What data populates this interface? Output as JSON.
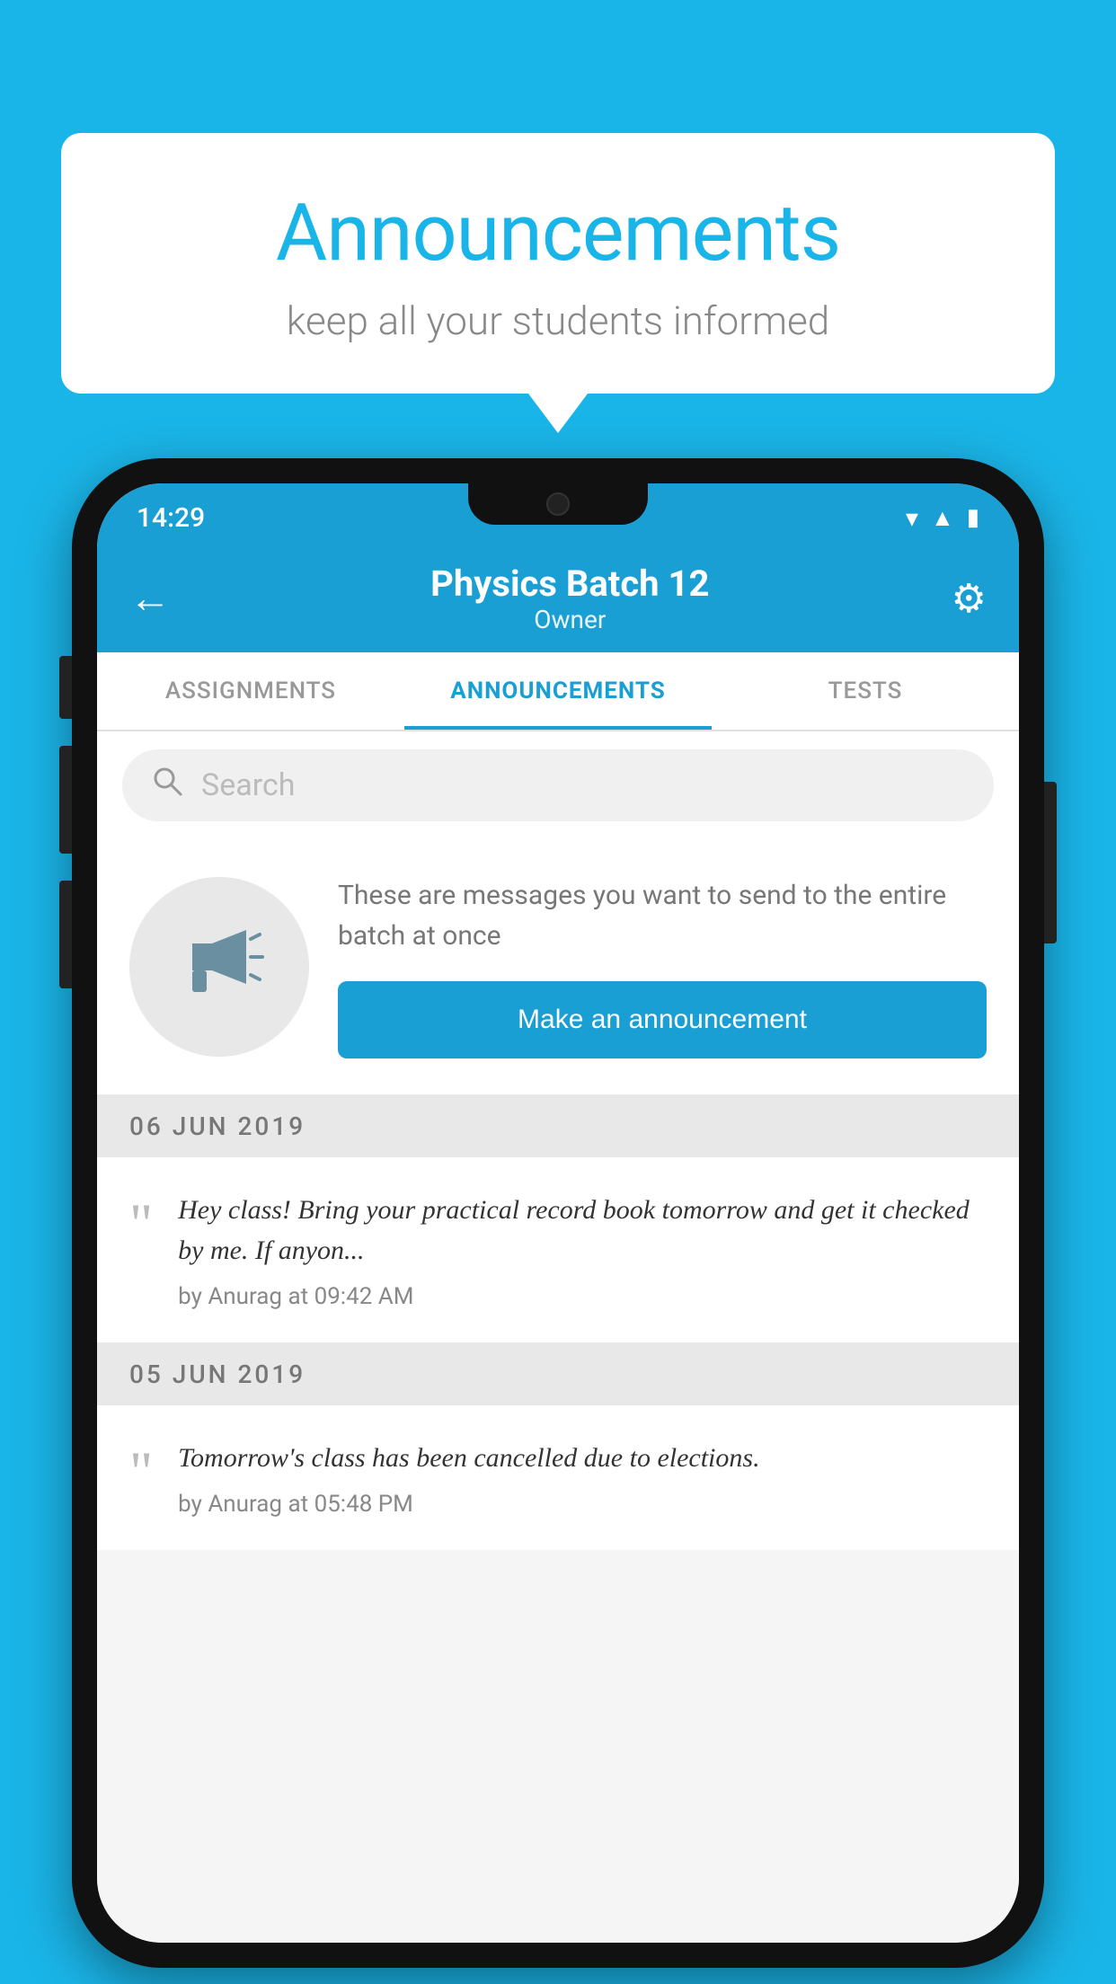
{
  "background_color": "#1ab5e8",
  "speech_bubble": {
    "title": "Announcements",
    "subtitle": "keep all your students informed"
  },
  "status_bar": {
    "time": "14:29",
    "icons": [
      "wifi",
      "signal",
      "battery"
    ]
  },
  "app_bar": {
    "back_label": "←",
    "title": "Physics Batch 12",
    "subtitle": "Owner",
    "settings_label": "⚙"
  },
  "tabs": [
    {
      "label": "ASSIGNMENTS",
      "active": false
    },
    {
      "label": "ANNOUNCEMENTS",
      "active": true
    },
    {
      "label": "TESTS",
      "active": false
    }
  ],
  "search": {
    "placeholder": "Search"
  },
  "promo": {
    "text": "These are messages you want to send to the entire batch at once",
    "button_label": "Make an announcement"
  },
  "announcements": [
    {
      "date": "06  JUN  2019",
      "text": "Hey class! Bring your practical record book tomorrow and get it checked by me. If anyon...",
      "meta": "by Anurag at 09:42 AM"
    },
    {
      "date": "05  JUN  2019",
      "text": "Tomorrow's class has been cancelled due to elections.",
      "meta": "by Anurag at 05:48 PM"
    }
  ]
}
